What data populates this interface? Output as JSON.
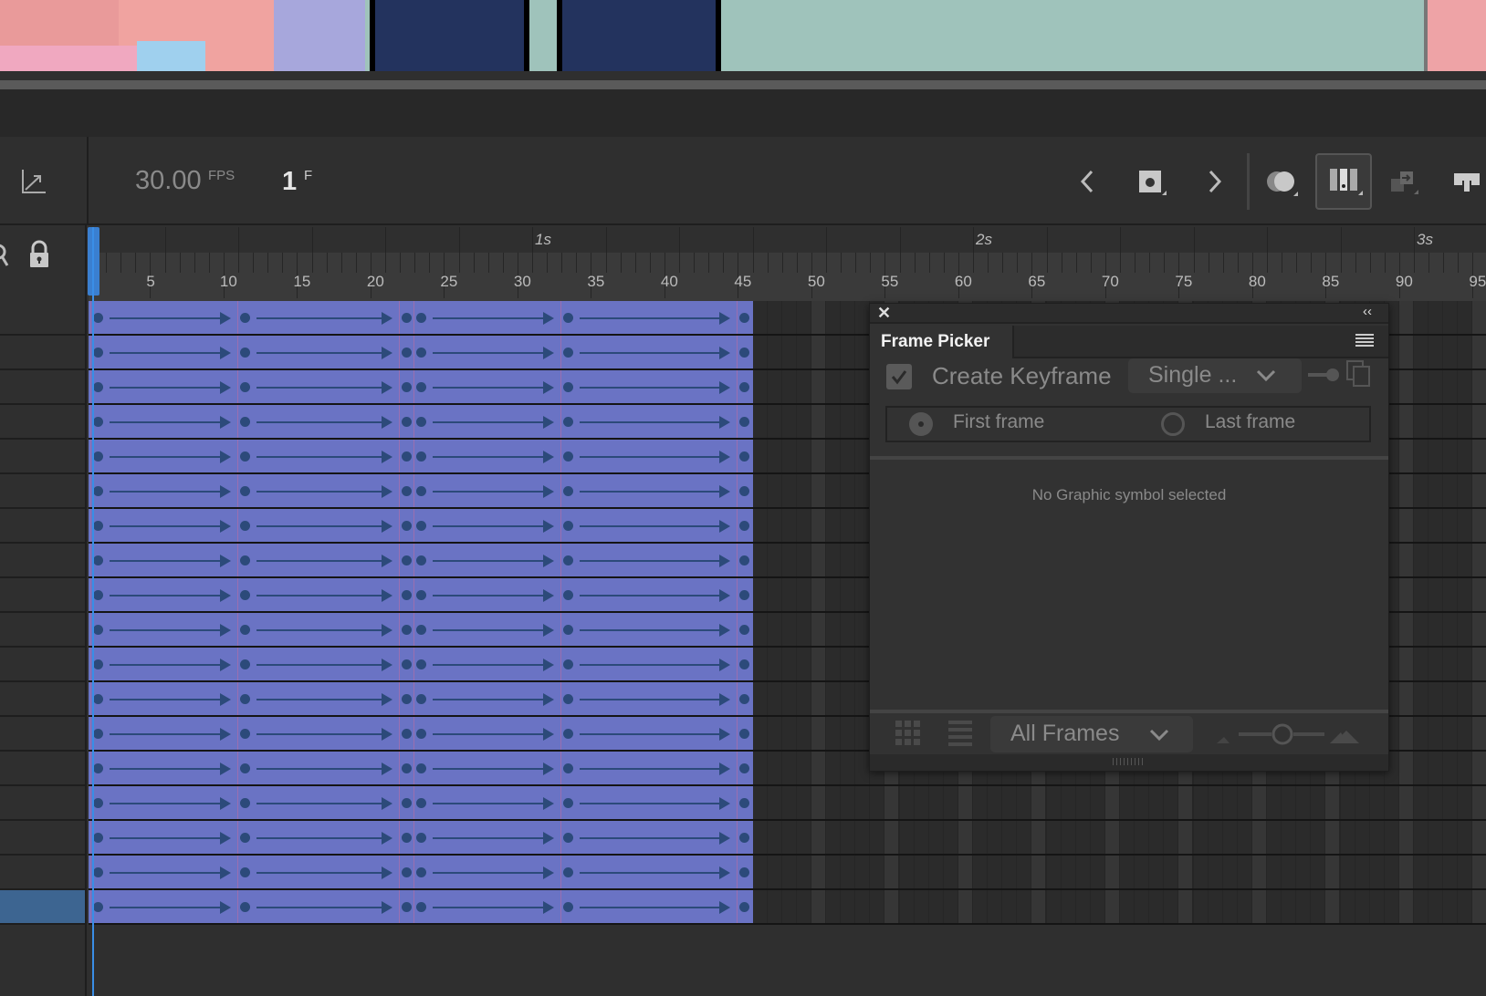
{
  "toolbar": {
    "fps_value": "30.00",
    "fps_unit": "FPS",
    "frame_value": "1",
    "frame_unit": "F",
    "icons": [
      "graph-icon",
      "prev-keyframe-icon",
      "insert-keyframe-icon",
      "next-keyframe-icon",
      "onion-skin-icon",
      "frame-view-icon",
      "loop-icon",
      "center-frame-icon"
    ]
  },
  "timeline": {
    "seconds_labels": [
      {
        "frame": 31,
        "label": "1s"
      },
      {
        "frame": 61,
        "label": "2s"
      },
      {
        "frame": 91,
        "label": "3s"
      }
    ],
    "frame_labels": [
      "5",
      "10",
      "15",
      "20",
      "25",
      "30",
      "35",
      "40",
      "45",
      "50",
      "55",
      "60",
      "65",
      "70",
      "75",
      "80",
      "85",
      "90",
      "95"
    ],
    "current_frame": 1,
    "layer_count": 18,
    "selected_layer": 18,
    "keyframes": [
      1,
      11,
      22,
      23,
      33,
      45
    ],
    "tweens": [
      [
        1,
        10
      ],
      [
        11,
        21
      ],
      [
        23,
        32
      ],
      [
        33,
        44
      ]
    ],
    "span_end": 45,
    "colors": {
      "tween": "#6a73c4",
      "keyframe": "#2c4a7a",
      "playhead": "#3a8ee6",
      "selected_layer": "#3d6591"
    }
  },
  "frame_picker": {
    "title": "Frame Picker",
    "create_keyframe_label": "Create Keyframe",
    "create_keyframe_checked": true,
    "mode_value": "Single ...",
    "first_frame_label": "First frame",
    "last_frame_label": "Last frame",
    "selected_radio": "First frame",
    "empty_message": "No Graphic symbol selected",
    "filter_value": "All Frames"
  }
}
